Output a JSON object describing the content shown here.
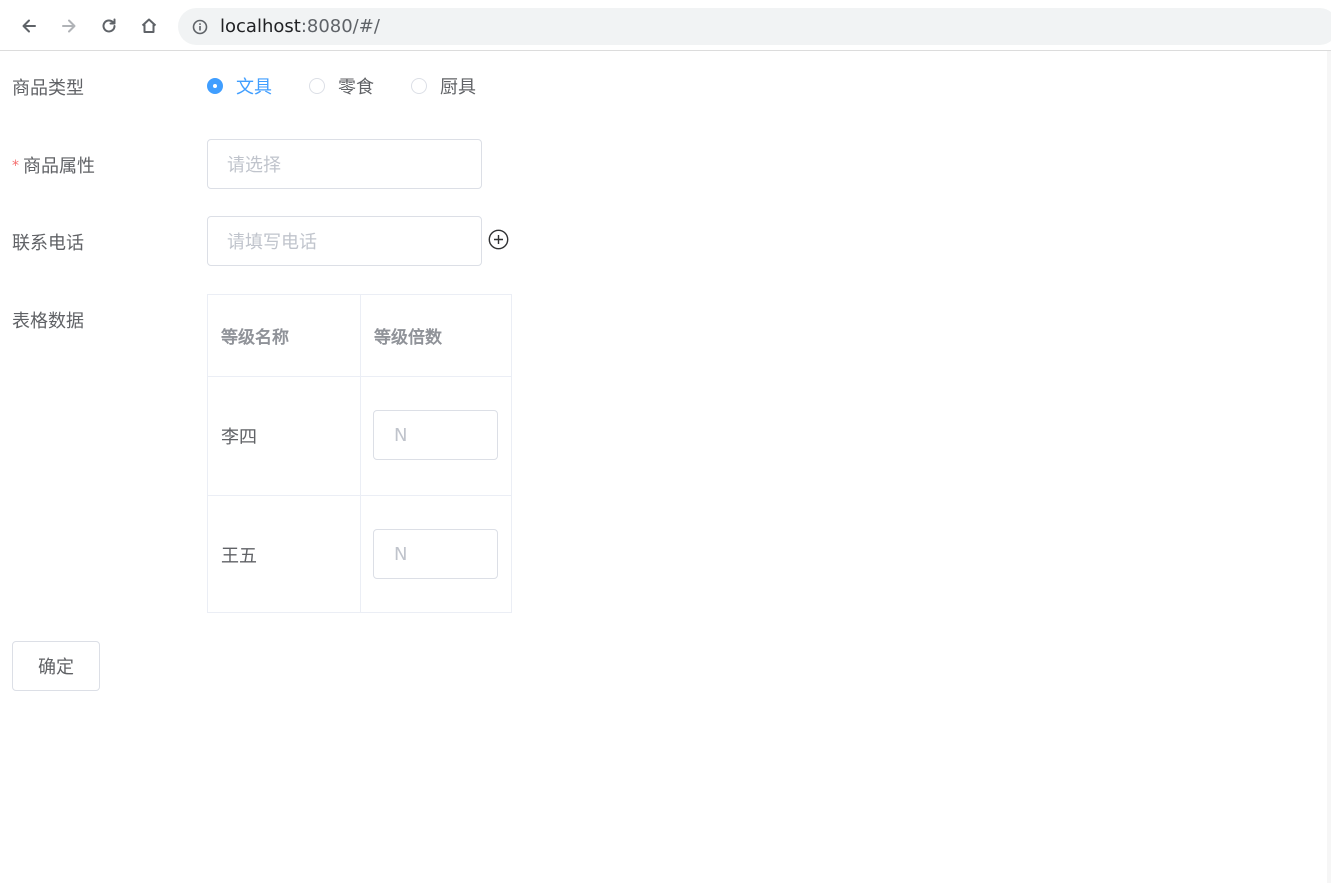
{
  "browser": {
    "url_host": "localhost",
    "url_rest": ":8080/#/",
    "icons": [
      "back-arrow-icon",
      "forward-arrow-icon",
      "reload-icon",
      "home-icon",
      "info-icon"
    ]
  },
  "form": {
    "product_type": {
      "label": "商品类型",
      "options": [
        "文具",
        "零食",
        "厨具"
      ],
      "selected": "文具"
    },
    "product_attr": {
      "label": "商品属性",
      "required_mark": "*",
      "placeholder": "请选择"
    },
    "phone": {
      "label": "联系电话",
      "placeholder": "请填写电话",
      "add_icon": "plus-circle-icon"
    },
    "table": {
      "label": "表格数据",
      "columns": [
        "等级名称",
        "等级倍数"
      ],
      "rows": [
        {
          "name": "李四",
          "multiplier_placeholder": "N"
        },
        {
          "name": "王五",
          "multiplier_placeholder": "N"
        }
      ]
    },
    "submit_label": "确定"
  },
  "colors": {
    "primary": "#409eff",
    "text": "#606266",
    "placeholder": "#c0c4cc",
    "border": "#dcdfe6",
    "required": "#f56c6c"
  }
}
